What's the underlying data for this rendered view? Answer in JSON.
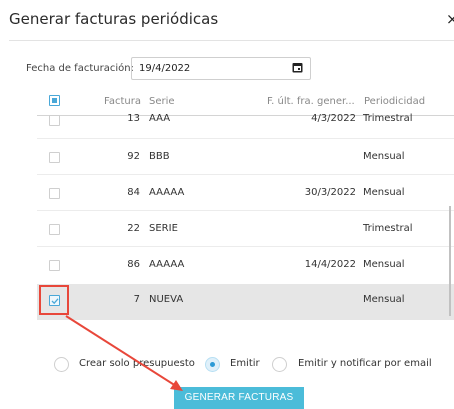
{
  "dialog": {
    "title": "Generar facturas periódicas",
    "close_icon": "×"
  },
  "date": {
    "label": "Fecha de facturación:",
    "value": "19/4/2022"
  },
  "table": {
    "headers": {
      "factura": "Factura",
      "serie": "Serie",
      "fecha": "F. últ. fra. gener...",
      "periodicidad": "Periodicidad"
    },
    "rows": [
      {
        "factura": "13",
        "serie": "AAA",
        "fecha": "4/3/2022",
        "periodicidad": "Trimestral",
        "checked": false
      },
      {
        "factura": "92",
        "serie": "BBB",
        "fecha": "",
        "periodicidad": "Mensual",
        "checked": false
      },
      {
        "factura": "84",
        "serie": "AAAAA",
        "fecha": "30/3/2022",
        "periodicidad": "Mensual",
        "checked": false
      },
      {
        "factura": "22",
        "serie": "SERIE",
        "fecha": "",
        "periodicidad": "Trimestral",
        "checked": false
      },
      {
        "factura": "86",
        "serie": "AAAAA",
        "fecha": "14/4/2022",
        "periodicidad": "Mensual",
        "checked": false
      },
      {
        "factura": "7",
        "serie": "NUEVA",
        "fecha": "",
        "periodicidad": "Mensual",
        "checked": true
      }
    ]
  },
  "options": {
    "presupuesto": "Crear solo presupuesto",
    "emitir": "Emitir",
    "emitir_notificar": "Emitir y notificar por email",
    "selected": "emitir"
  },
  "generate_button": "GENERAR FACTURAS",
  "colors": {
    "accent": "#4bbcd9",
    "annotation": "#e8473a"
  }
}
